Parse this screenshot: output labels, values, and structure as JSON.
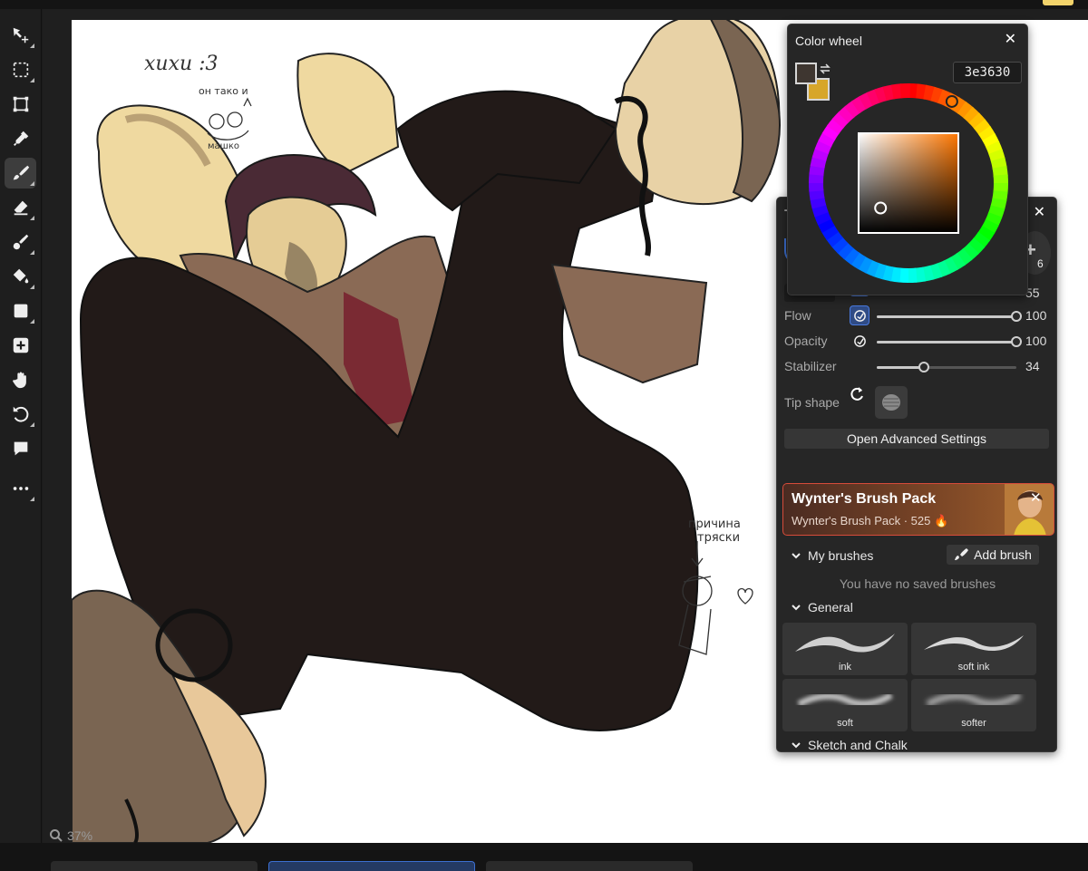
{
  "canvas": {
    "zoom": "37%",
    "sketch_notes": {
      "top_left": "хихи :3",
      "small_top": "он тако и",
      "small_bottom": "машко",
      "bottom_right_line1": "причина",
      "bottom_right_line2": "тряски"
    }
  },
  "colors": {
    "accent": "#3c6fd1",
    "foreground": "#3e3630",
    "background": "#d7a62a",
    "panel_bg": "#262626"
  },
  "color_wheel": {
    "title": "Color wheel",
    "hex": "3e3630",
    "hue_marker_deg": 28,
    "sv_marker": {
      "saturation": 0.22,
      "value": 0.25
    }
  },
  "brush_panel": {
    "title": "T",
    "size_value": "55",
    "extra_count": "6",
    "rows": [
      {
        "label": "Flow",
        "value": "100",
        "fraction": 1.0,
        "pressure_on": true
      },
      {
        "label": "Opacity",
        "value": "100",
        "fraction": 1.0,
        "pressure_on": false
      },
      {
        "label": "Stabilizer",
        "value": "34",
        "fraction": 0.34,
        "pressure_on": false
      }
    ],
    "tip_shape_label": "Tip shape",
    "advanced_label": "Open Advanced Settings",
    "pack": {
      "title": "Wynter's Brush Pack",
      "subtitle": "Wynter's Brush Pack · 525"
    },
    "my_brushes_label": "My brushes",
    "add_brush_label": "Add brush",
    "empty_note": "You have no saved brushes",
    "general_label": "General",
    "brushes": [
      {
        "name": "ink"
      },
      {
        "name": "soft ink"
      },
      {
        "name": "soft"
      },
      {
        "name": "softer"
      }
    ],
    "sketch_label": "Sketch and Chalk"
  }
}
